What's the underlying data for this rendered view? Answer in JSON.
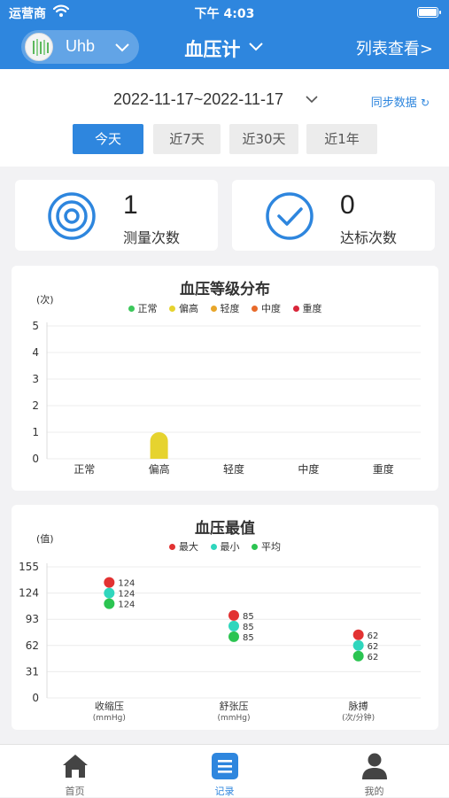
{
  "status_bar": {
    "carrier": "运营商",
    "time": "下午 4:03"
  },
  "nav": {
    "user_name": "Uhb",
    "title": "血压计",
    "right_link": "列表查看>"
  },
  "filter": {
    "date_range": "2022-11-17~2022-11-17",
    "sync_label": "同步数据",
    "tabs": [
      {
        "label": "今天",
        "active": true
      },
      {
        "label": "近7天",
        "active": false
      },
      {
        "label": "近30天",
        "active": false
      },
      {
        "label": "近1年",
        "active": false
      }
    ]
  },
  "stats": {
    "measure": {
      "value": "1",
      "label": "测量次数"
    },
    "target": {
      "value": "0",
      "label": "达标次数"
    }
  },
  "colors": {
    "primary": "#2e86de",
    "normal": "#3cc85b",
    "elevated": "#e6d32f",
    "mild": "#e8a62a",
    "moderate": "#e86a2a",
    "severe": "#d9263a",
    "max": "#e23232",
    "min": "#2fd6bd",
    "avg": "#2bc451"
  },
  "chart_data": [
    {
      "type": "bar",
      "title": "血压等级分布",
      "unit_label": "(次)",
      "categories": [
        "正常",
        "偏高",
        "轻度",
        "中度",
        "重度"
      ],
      "legend": [
        "正常",
        "偏高",
        "轻度",
        "中度",
        "重度"
      ],
      "values": [
        0,
        1,
        0,
        0,
        0
      ],
      "ylim": [
        0,
        5
      ],
      "yticks": [
        "0",
        "1",
        "2",
        "3",
        "4",
        "5"
      ],
      "grid": true,
      "legend_position": "top"
    },
    {
      "type": "scatter",
      "title": "血压最值",
      "unit_label": "(值)",
      "categories": [
        "收缩压",
        "舒张压",
        "脉搏"
      ],
      "category_units": [
        "(mmHg)",
        "(mmHg)",
        "(次/分钟)"
      ],
      "series": [
        {
          "name": "最大",
          "values": [
            124,
            85,
            62
          ]
        },
        {
          "name": "最小",
          "values": [
            124,
            85,
            62
          ]
        },
        {
          "name": "平均",
          "values": [
            124,
            85,
            62
          ]
        }
      ],
      "ylim": [
        0,
        155
      ],
      "yticks": [
        "0",
        "31",
        "62",
        "93",
        "124",
        "155"
      ],
      "grid": true,
      "legend_position": "top"
    }
  ],
  "tabbar": [
    {
      "label": "首页",
      "icon": "home-icon",
      "active": false
    },
    {
      "label": "记录",
      "icon": "records-icon",
      "active": true
    },
    {
      "label": "我的",
      "icon": "person-icon",
      "active": false
    }
  ]
}
